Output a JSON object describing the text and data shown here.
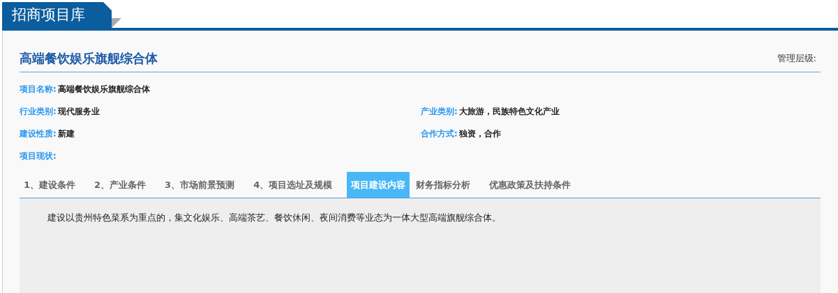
{
  "header": {
    "title": "招商项目库"
  },
  "project": {
    "title": "高端餐饮娱乐旗舰综合体",
    "management_level_label": "管理层级:"
  },
  "field_rows": [
    {
      "left": {
        "label": "项目名称:",
        "value": "高端餐饮娱乐旗舰综合体"
      }
    },
    {
      "left": {
        "label": "行业类别:",
        "value": "现代服务业"
      },
      "right": {
        "label": "产业类别:",
        "value": "大旅游，民族特色文化产业"
      }
    },
    {
      "left": {
        "label": "建设性质:",
        "value": "新建"
      },
      "right": {
        "label": "合作方式:",
        "value": "独资，合作"
      }
    },
    {
      "left": {
        "label": "项目现状:"
      }
    }
  ],
  "tabs": [
    {
      "label": "1、建设条件",
      "selected": false
    },
    {
      "label": "2、产业条件",
      "selected": false
    },
    {
      "label": "3、市场前景预测",
      "selected": false
    },
    {
      "label": "4、项目选址及规模",
      "selected": false
    },
    {
      "label": "项目建设内容",
      "selected": true
    },
    {
      "label": "财务指标分析",
      "selected": false
    },
    {
      "label": "优惠政策及扶持条件",
      "selected": false
    }
  ],
  "content": {
    "text": "建设以贵州特色菜系为重点的，集文化娱乐、高端茶艺、餐饮休闲、夜间消费等业态为一体大型高端旗舰综合体。"
  }
}
